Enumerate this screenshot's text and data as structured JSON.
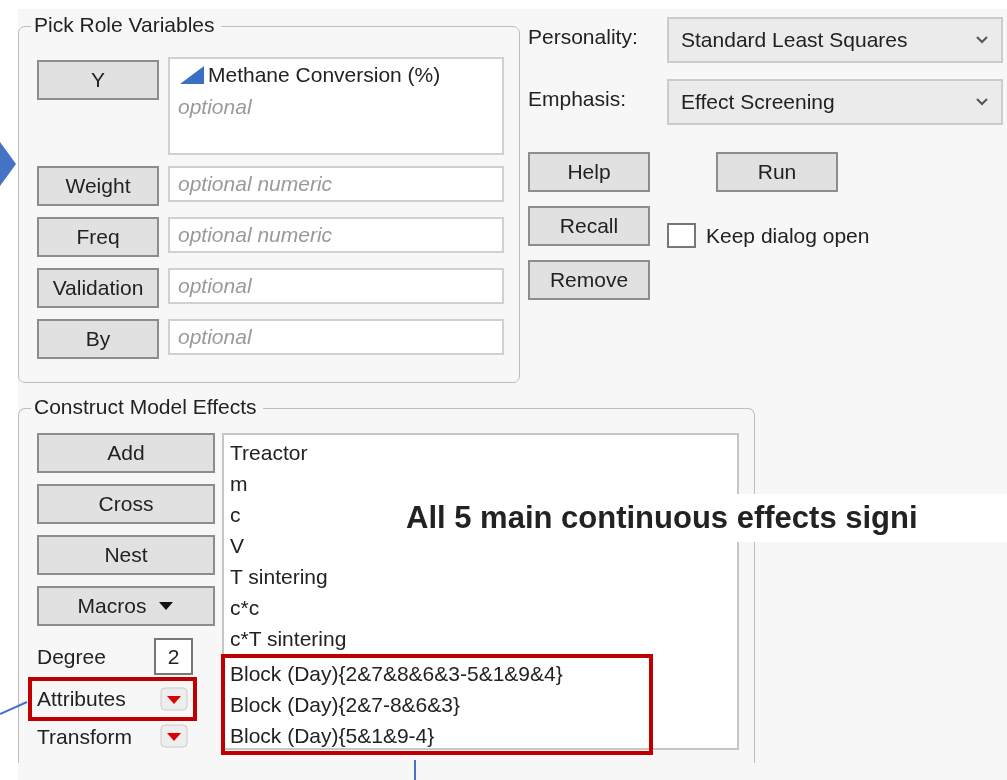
{
  "pick_role_variables": {
    "title": "Pick Role Variables",
    "roles": [
      {
        "button": "Y",
        "items": [
          {
            "name": "Methane Conversion (%)",
            "kind": "continuous"
          }
        ],
        "placeholder": "optional"
      },
      {
        "button": "Weight",
        "placeholder": "optional numeric"
      },
      {
        "button": "Freq",
        "placeholder": "optional numeric"
      },
      {
        "button": "Validation",
        "placeholder": "optional"
      },
      {
        "button": "By",
        "placeholder": "optional"
      }
    ]
  },
  "personality": {
    "label": "Personality:",
    "value": "Standard Least Squares"
  },
  "emphasis": {
    "label": "Emphasis:",
    "value": "Effect Screening"
  },
  "buttons": {
    "help": "Help",
    "run": "Run",
    "recall": "Recall",
    "remove": "Remove"
  },
  "keep_dialog_open": {
    "label": "Keep dialog open",
    "checked": false
  },
  "construct_model_effects": {
    "title": "Construct Model Effects",
    "buttons": [
      {
        "label": "Add",
        "kind": "button"
      },
      {
        "label": "Cross",
        "kind": "button"
      },
      {
        "label": "Nest",
        "kind": "button"
      },
      {
        "label": "Macros",
        "kind": "menu"
      }
    ],
    "degree": {
      "label": "Degree",
      "value": "2"
    },
    "attributes": {
      "label": "Attributes",
      "highlighted": true
    },
    "transform": {
      "label": "Transform",
      "highlighted": false
    },
    "effects": [
      {
        "name": "Treactor",
        "highlighted": false
      },
      {
        "name": "m",
        "highlighted": false
      },
      {
        "name": "c",
        "highlighted": false
      },
      {
        "name": "V",
        "highlighted": false
      },
      {
        "name": "T sintering",
        "highlighted": false
      },
      {
        "name": "c*c",
        "highlighted": false
      },
      {
        "name": "c*T sintering",
        "highlighted": false
      },
      {
        "name": "Block (Day){2&7&8&6&3-5&1&9&4}",
        "highlighted": true
      },
      {
        "name": "Block (Day){2&7-8&6&3}",
        "highlighted": true
      },
      {
        "name": "Block (Day){5&1&9-4}",
        "highlighted": true
      }
    ]
  },
  "annotation": {
    "text": "All 5 main continuous effects signi"
  }
}
